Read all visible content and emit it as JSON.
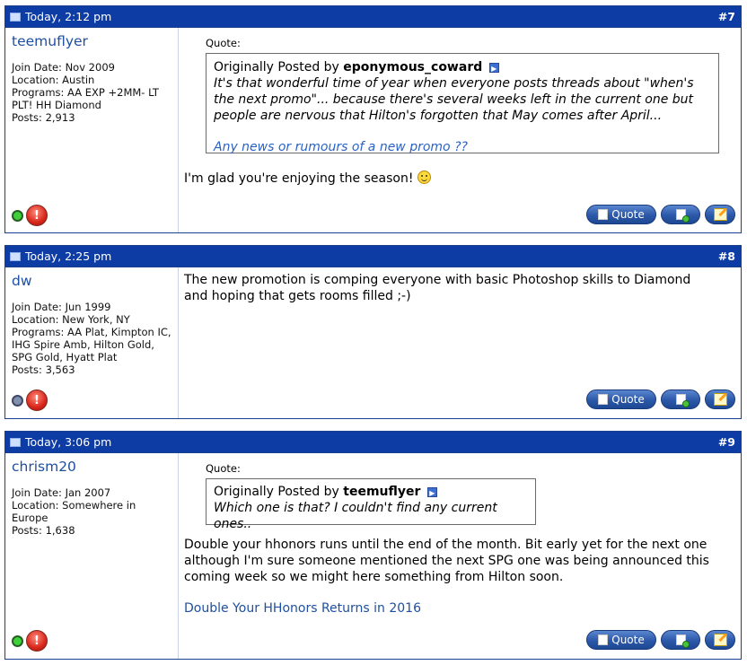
{
  "posts": [
    {
      "time": "Today, 2:12 pm",
      "number": "#7",
      "username": "teemuflyer",
      "details": [
        "Join Date: Nov 2009",
        "Location: Austin",
        "Programs: AA EXP +2MM- LT PLT! HH Diamond",
        "Posts: 2,913"
      ],
      "online": true,
      "quote": {
        "label": "Quote:",
        "by_prefix": "Originally Posted by",
        "author": "eponymous_coward",
        "text": "It's that wonderful time of year when everyone posts threads about \"when's the next promo\"... because there's several weeks left in the current one but people are nervous that Hilton's forgotten that May comes after April...",
        "extra": "Any news or rumours of a new promo ??"
      },
      "message": "I'm glad you're enjoying the season!",
      "link": "",
      "quote_button": "Quote"
    },
    {
      "time": "Today, 2:25 pm",
      "number": "#8",
      "username": "dw",
      "details": [
        "Join Date: Jun 1999",
        "Location: New York, NY",
        "Programs: AA Plat, Kimpton IC, IHG Spire Amb, Hilton Gold, SPG Gold, Hyatt Plat",
        "Posts: 3,563"
      ],
      "online": false,
      "message": "The new promotion is comping everyone with basic Photoshop skills to Diamond and hoping that gets rooms filled ;-)",
      "link": "",
      "quote_button": "Quote"
    },
    {
      "time": "Today, 3:06 pm",
      "number": "#9",
      "username": "chrism20",
      "details": [
        "Join Date: Jan 2007",
        "Location: Somewhere in Europe",
        "Posts: 1,638"
      ],
      "online": true,
      "quote": {
        "label": "Quote:",
        "by_prefix": "Originally Posted by",
        "author": "teemuflyer",
        "text": "Which one is that? I couldn't find any current ones..",
        "extra": ""
      },
      "message": "Double your hhonors runs until the end of the month. Bit early yet for the next one although I'm sure someone mentioned the next SPG one was being announced this coming week so we might here something from Hilton soon.",
      "link": "Double Your HHonors Returns in 2016",
      "quote_button": "Quote"
    }
  ],
  "icons": {
    "post_icon": "post-icon",
    "online": "online-status-icon",
    "offline": "offline-status-icon",
    "report": "report-post-icon",
    "multiquote": "multi-quote-icon",
    "edit": "edit-post-icon",
    "view_post": "view-post-arrow-icon",
    "smiley": "smiley-icon"
  },
  "colors": {
    "header_bg": "#0e3ca5",
    "username": "#1f4fa0",
    "button": "#2b58a8",
    "online": "#3ed13a",
    "report": "#d8261a"
  }
}
